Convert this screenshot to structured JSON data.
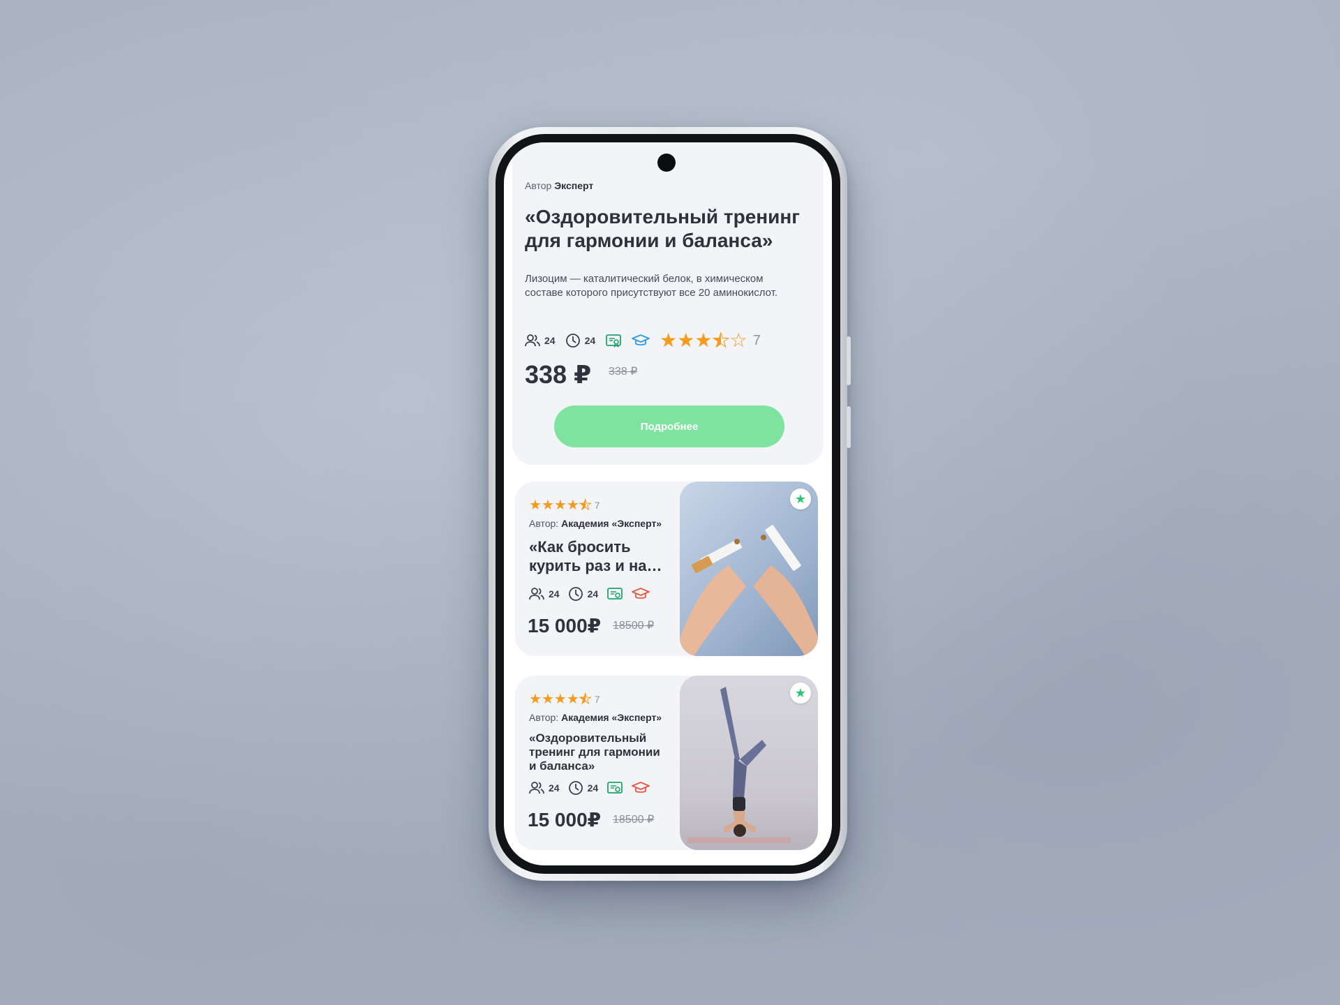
{
  "hero": {
    "author_prefix": "Автор",
    "author_name": "Эксперт",
    "title": "«Оздоровительный тренинг для гармонии и баланса»",
    "description": "Лизоцим — каталитический белок, в химическом составе которого присутствуют все 20 аминокислот.",
    "students": "24",
    "hours": "24",
    "rating_count": "7",
    "rating_value": 3.5,
    "price": "338 ₽",
    "old_price": "338 ₽",
    "cta_label": "Подробнее"
  },
  "cards": [
    {
      "rating_count": "7",
      "rating_value": 4.5,
      "author_prefix": "Автор:",
      "author_name": "Академия «Эксперт»",
      "title": "«Как бросить курить раз и на…",
      "students": "24",
      "hours": "24",
      "price": "15 000₽",
      "old_price": "18500 ₽"
    },
    {
      "rating_count": "7",
      "rating_value": 4.5,
      "author_prefix": "Автор:",
      "author_name": "Академия «Эксперт»",
      "title": "«Оздоровительный тренинг для гармонии и баланса»",
      "students": "24",
      "hours": "24",
      "price": "15 000₽",
      "old_price": "18500 ₽"
    }
  ],
  "colors": {
    "accent_green": "#7de39e",
    "star_orange": "#f59a1b",
    "certificate_green": "#1fa466",
    "education_blue": "#2f9be0",
    "education_red": "#e8573f"
  },
  "icons": [
    "users-icon",
    "clock-icon",
    "certificate-icon",
    "graduation-cap-icon",
    "star-icon",
    "favorite-star-icon"
  ]
}
